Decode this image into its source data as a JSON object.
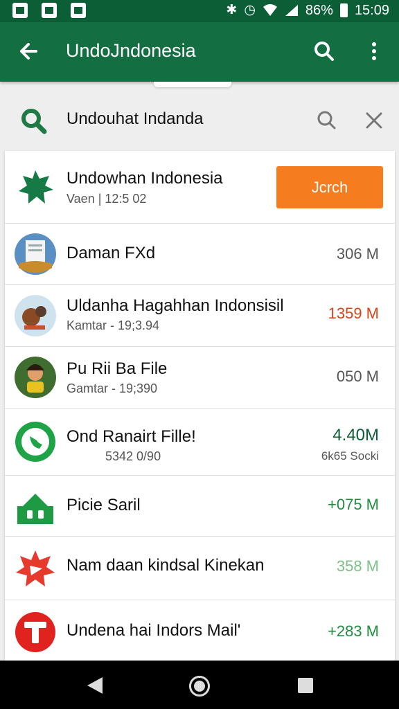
{
  "status": {
    "battery": "86%",
    "time": "15:09"
  },
  "toolbar": {
    "title": "UndoJndonesia"
  },
  "search": {
    "query": "Undouhat Indanda"
  },
  "featured": {
    "name": "Undowhan Indonesia",
    "meta": "Vaen | 12:5 02",
    "button": "Jcrch"
  },
  "items": [
    {
      "name": "Daman FXd",
      "sub": "",
      "size": "306 M",
      "size_color": "#555555"
    },
    {
      "name": "Uldanha Hagahhan Indonsisil",
      "sub": "Kamtar - 19;3.94",
      "size": "1359 M",
      "size_color": "#d84315"
    },
    {
      "name": "Pu Rii Ba File",
      "sub": "Gamtar - 19;390",
      "size": "050 M",
      "size_color": "#555555"
    },
    {
      "name": "Ond Ranairt Fille!",
      "sub": "5342 0/90",
      "size": "4.40M",
      "size_sub": "6k65 Socki",
      "size_color": "#0b5e36"
    },
    {
      "name": "Picie Saril",
      "sub": "",
      "size": "+075 M",
      "size_color": "#1e8e3e"
    },
    {
      "name": "Nam daan  kindsal Kinekan",
      "sub": "",
      "size": "358 M",
      "size_color": "#7cbf86"
    },
    {
      "name": "Undena hai Indors Mail'",
      "sub": "",
      "size": "+283 M",
      "size_color": "#1e8e3e"
    }
  ],
  "icons": {
    "toolbar": [
      "back-arrow-icon",
      "search-icon",
      "more-vert-icon"
    ],
    "searchrow": [
      "search-icon",
      "search-icon",
      "close-icon"
    ],
    "nav": [
      "nav-back-icon",
      "nav-home-icon",
      "nav-recents-icon"
    ]
  },
  "colors": {
    "statusbar": "#0b5e36",
    "toolbar": "#136f42",
    "accent_button": "#f57c1f"
  }
}
